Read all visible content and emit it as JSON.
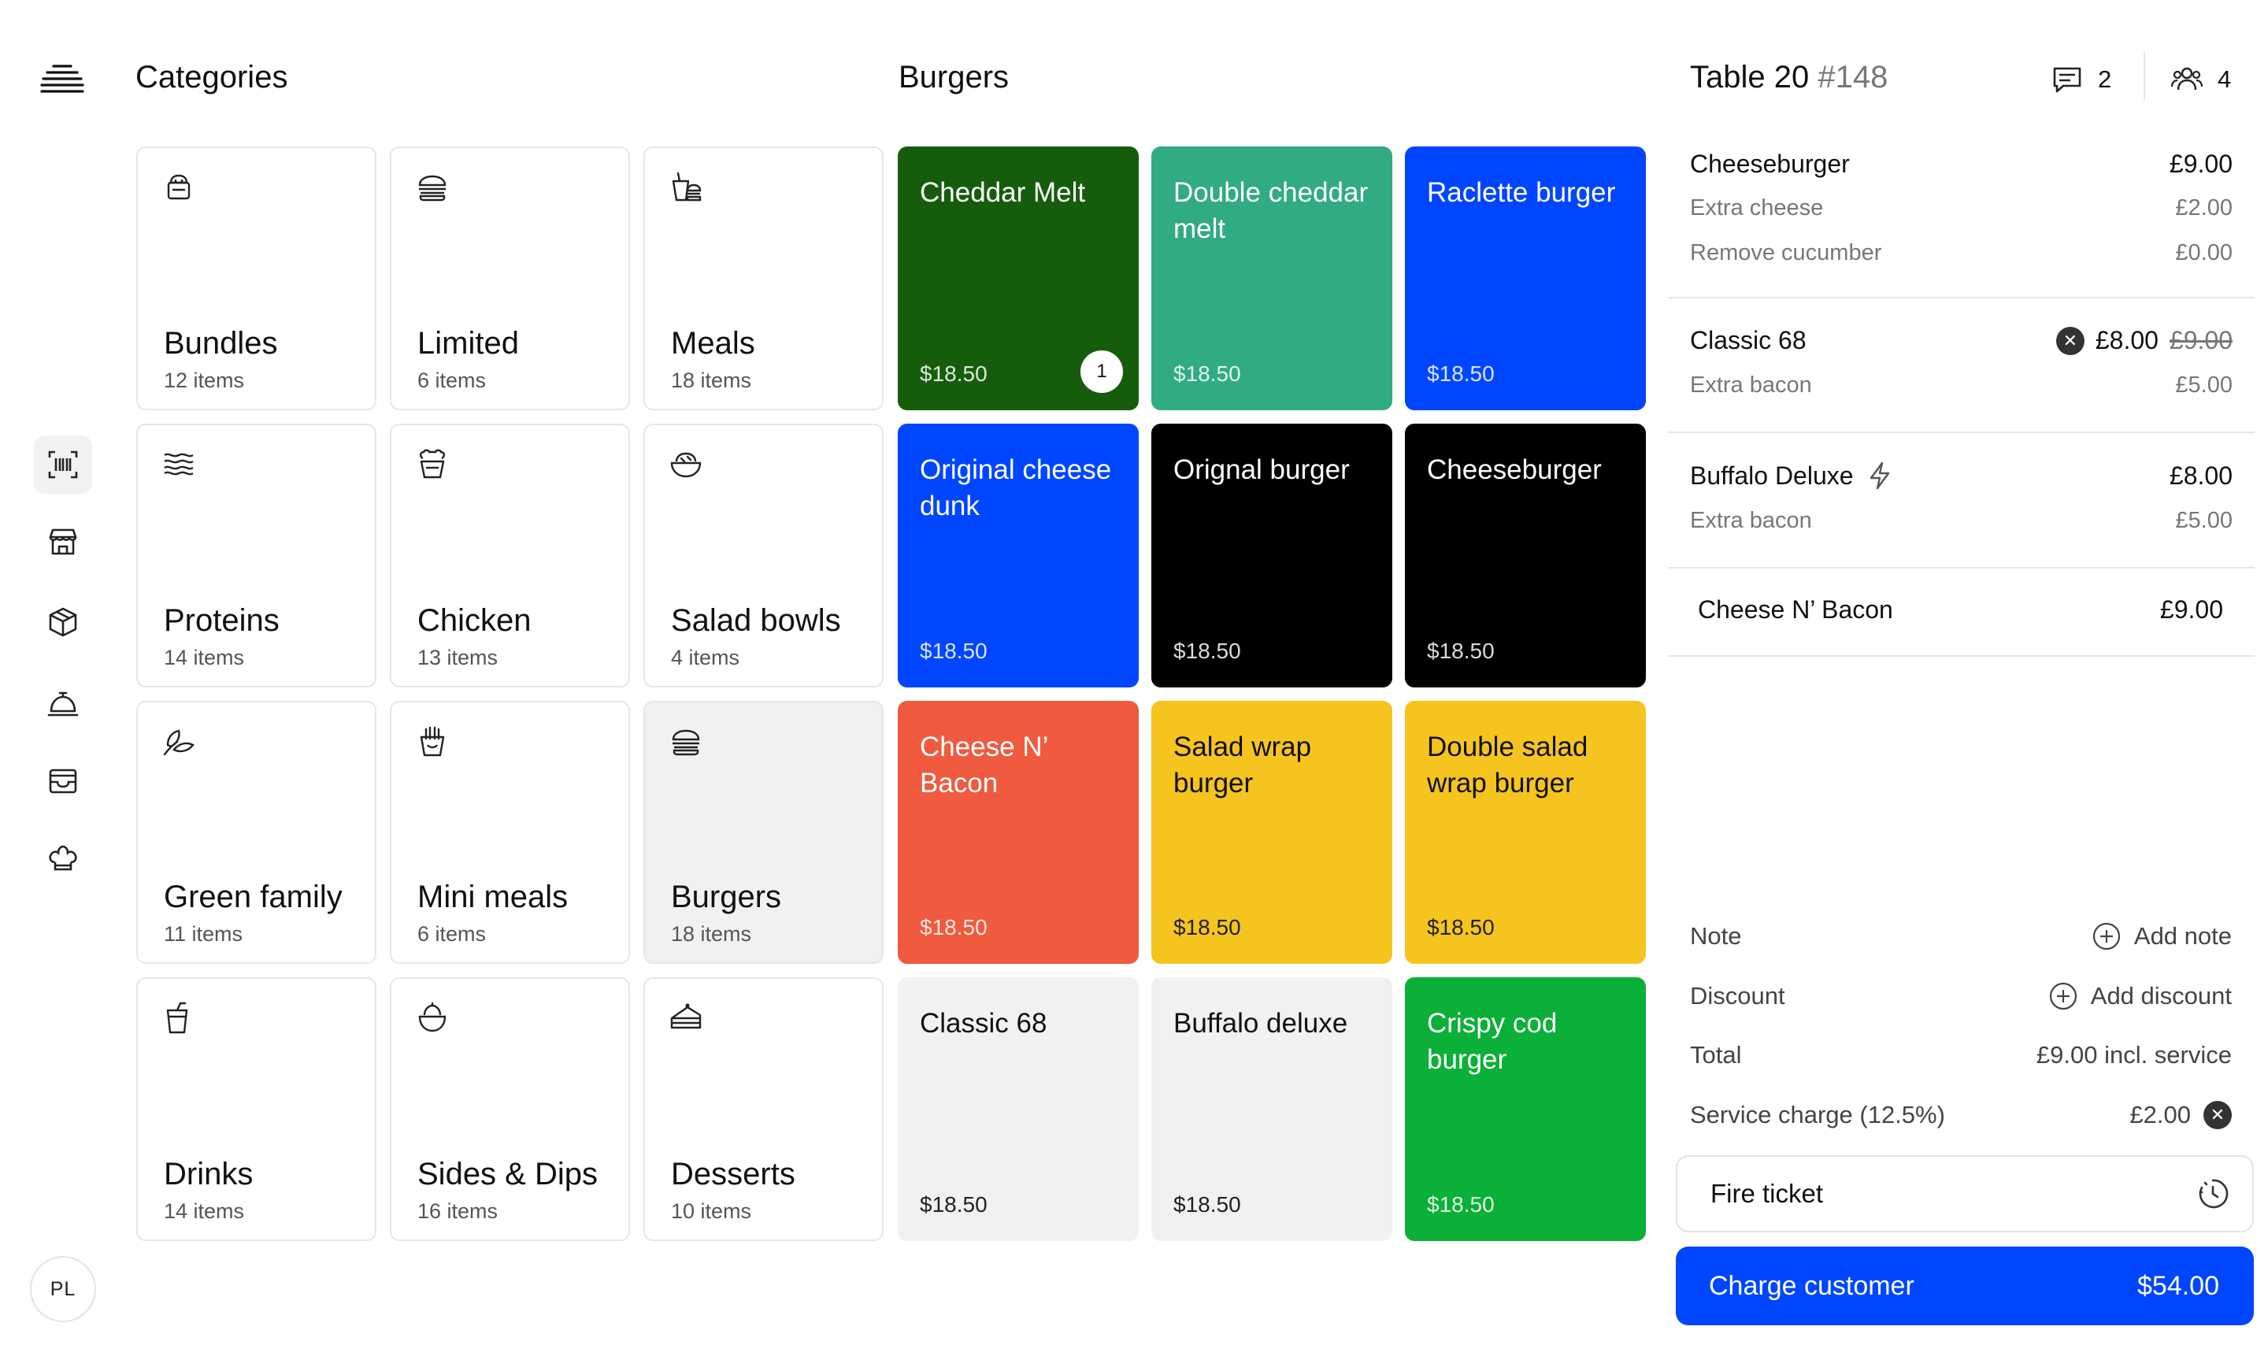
{
  "colors": {
    "accent_blue": "#0046ff",
    "dark_green": "#155d0c",
    "teal": "#31ab80",
    "black": "#000000",
    "orange": "#f05a3e",
    "yellow": "#f5c41e",
    "light_gray": "#f1f1f1",
    "green": "#0bb038"
  },
  "rail": {
    "logo_icon": "stacked-lines-logo",
    "items": [
      {
        "icon": "barcode-scan-icon",
        "active": true
      },
      {
        "icon": "store-icon",
        "active": false
      },
      {
        "icon": "box-icon",
        "active": false
      },
      {
        "icon": "service-bell-icon",
        "active": false
      },
      {
        "icon": "inbox-icon",
        "active": false
      },
      {
        "icon": "chef-hat-icon",
        "active": false
      }
    ],
    "avatar_initials": "PL"
  },
  "categories": {
    "title": "Categories",
    "items": [
      {
        "name": "Bundles",
        "count": "12 items",
        "icon": "bundle-icon"
      },
      {
        "name": "Limited",
        "count": "6 items",
        "icon": "burger-icon"
      },
      {
        "name": "Meals",
        "count": "18 items",
        "icon": "meal-icon"
      },
      {
        "name": "Proteins",
        "count": "14 items",
        "icon": "bacon-icon"
      },
      {
        "name": "Chicken",
        "count": "13 items",
        "icon": "chicken-icon"
      },
      {
        "name": "Salad bowls",
        "count": "4 items",
        "icon": "salad-bowl-icon"
      },
      {
        "name": "Green family",
        "count": "11 items",
        "icon": "leaf-icon"
      },
      {
        "name": "Mini meals",
        "count": "6 items",
        "icon": "fries-icon"
      },
      {
        "name": "Burgers",
        "count": "18 items",
        "icon": "burger-icon",
        "selected": true
      },
      {
        "name": "Drinks",
        "count": "14 items",
        "icon": "drink-icon"
      },
      {
        "name": "Sides & Dips",
        "count": "16 items",
        "icon": "dip-icon"
      },
      {
        "name": "Desserts",
        "count": "10 items",
        "icon": "cake-slice-icon"
      }
    ]
  },
  "products": {
    "title": "Burgers",
    "items": [
      {
        "name": "Cheddar Melt",
        "price": "$18.50",
        "color": "#155d0c",
        "badge": "1"
      },
      {
        "name": "Double cheddar melt",
        "price": "$18.50",
        "color": "#31ab80"
      },
      {
        "name": "Raclette burger",
        "price": "$18.50",
        "color": "#0046ff"
      },
      {
        "name": "Original cheese dunk",
        "price": "$18.50",
        "color": "#0046ff"
      },
      {
        "name": "Orignal burger",
        "price": "$18.50",
        "color": "#000000"
      },
      {
        "name": "Cheeseburger",
        "price": "$18.50",
        "color": "#000000"
      },
      {
        "name": "Cheese N’ Bacon",
        "price": "$18.50",
        "color": "#f05a3e"
      },
      {
        "name": "Salad wrap burger",
        "price": "$18.50",
        "color": "#f5c41e",
        "dark_text": true
      },
      {
        "name": "Double salad wrap burger",
        "price": "$18.50",
        "color": "#f5c41e",
        "dark_text": true
      },
      {
        "name": "Classic 68",
        "price": "$18.50",
        "color": "#f1f1f1",
        "dark_text": true
      },
      {
        "name": "Buffalo deluxe",
        "price": "$18.50",
        "color": "#f1f1f1",
        "dark_text": true
      },
      {
        "name": "Crispy cod burger",
        "price": "$18.50",
        "color": "#0bb038"
      }
    ]
  },
  "ticket": {
    "table": "Table 20",
    "number": "#148",
    "comments_count": "2",
    "guests_count": "4",
    "items": [
      {
        "name": "Cheeseburger",
        "price": "£9.00",
        "modifiers": [
          {
            "name": "Extra cheese",
            "price": "£2.00"
          },
          {
            "name": "Remove cucumber",
            "price": "£0.00"
          }
        ]
      },
      {
        "name": "Classic 68",
        "price": "£8.00",
        "original_price": "£9.00",
        "modifiers": [
          {
            "name": "Extra bacon",
            "price": "£5.00"
          }
        ]
      },
      {
        "name": "Buffalo Deluxe",
        "price": "£8.00",
        "modifiers": [
          {
            "name": "Extra bacon",
            "price": "£5.00"
          }
        ]
      },
      {
        "name": "Cheese N’ Bacon",
        "price": "£9.00",
        "modifiers": []
      }
    ],
    "note_label": "Note",
    "add_note": "Add note",
    "discount_label": "Discount",
    "add_discount": "Add discount",
    "total_label": "Total",
    "total_value": "£9.00 incl. service",
    "service_label": "Service charge (12.5%)",
    "service_value": "£2.00",
    "fire_ticket": "Fire ticket",
    "charge_label": "Charge customer",
    "charge_amount": "$54.00"
  }
}
